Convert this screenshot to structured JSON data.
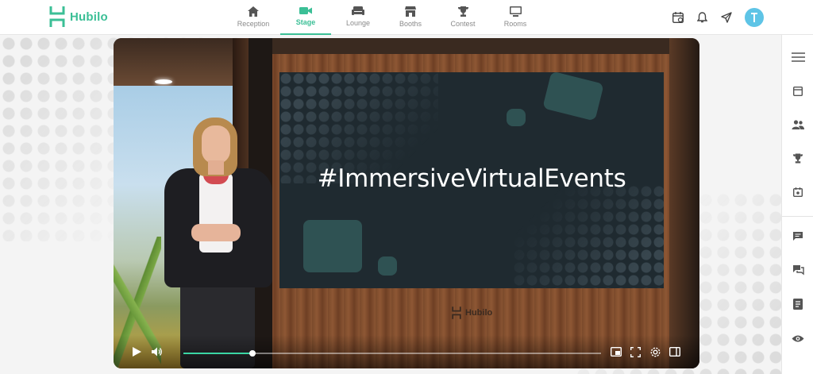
{
  "brand": {
    "name": "Hubilo",
    "accent_color": "#3bbf96"
  },
  "nav": {
    "items": [
      {
        "label": "Reception",
        "icon": "home-icon",
        "active": false
      },
      {
        "label": "Stage",
        "icon": "video-camera-icon",
        "active": true
      },
      {
        "label": "Lounge",
        "icon": "sofa-icon",
        "active": false
      },
      {
        "label": "Booths",
        "icon": "store-icon",
        "active": false
      },
      {
        "label": "Contest",
        "icon": "trophy-icon",
        "active": false
      },
      {
        "label": "Rooms",
        "icon": "monitor-icon",
        "active": false
      }
    ]
  },
  "top_actions": {
    "icons": [
      "calendar-icon",
      "bell-icon",
      "send-icon"
    ],
    "avatar_color": "#5ec4e6"
  },
  "video": {
    "screen_text": "#ImmersiveVirtualEvents",
    "stage_logo_text": "Hubilo",
    "progress": 0.165
  },
  "sidebar": {
    "icons": [
      "menu-icon",
      "schedule-icon",
      "people-icon",
      "trophy-icon",
      "calendar-check-icon",
      "chat-icon",
      "qa-icon",
      "notes-icon",
      "eye-icon"
    ]
  }
}
